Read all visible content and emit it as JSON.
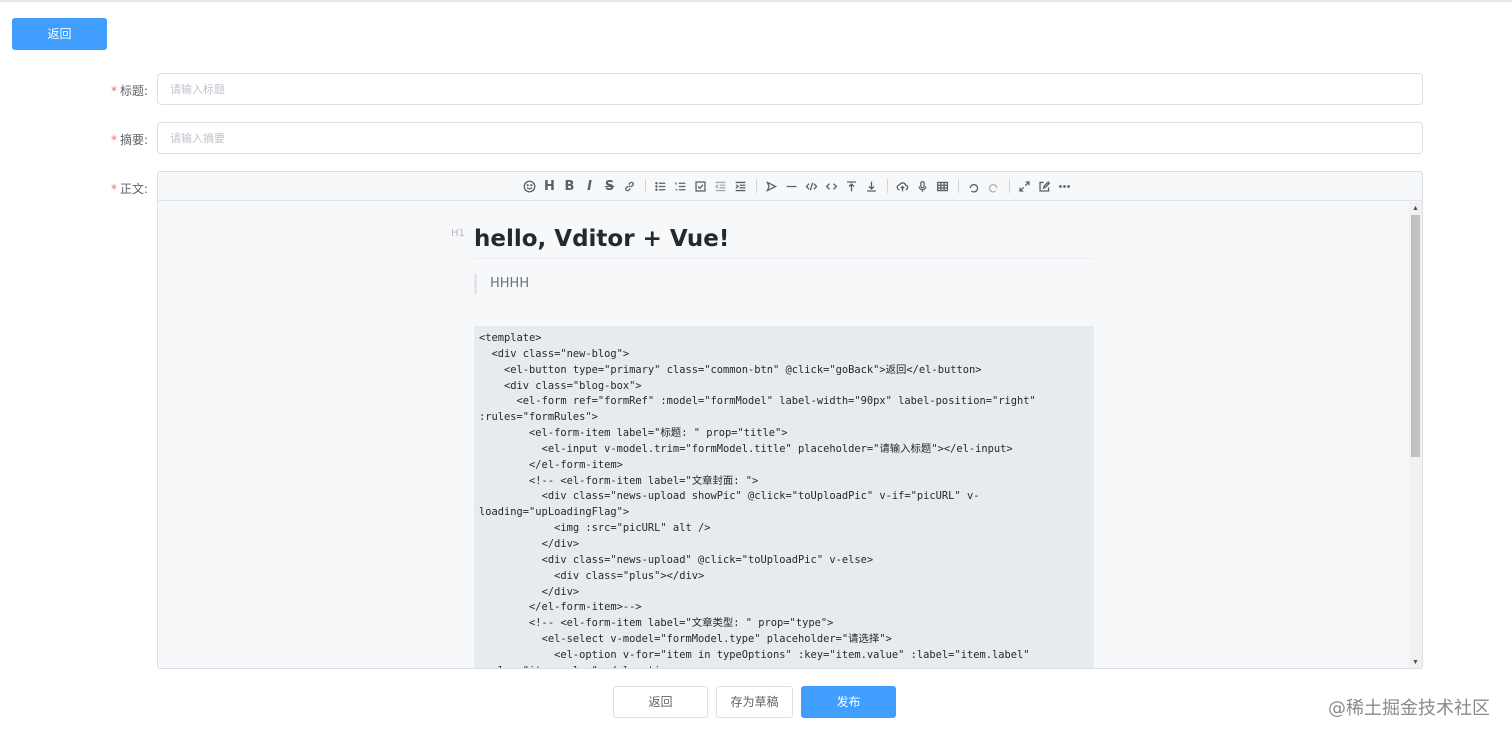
{
  "header": {
    "back_label": "返回"
  },
  "form": {
    "title": {
      "label": "标题:",
      "placeholder": "请输入标题",
      "value": ""
    },
    "summary": {
      "label": "摘要:",
      "placeholder": "请输入摘要",
      "value": ""
    },
    "body": {
      "label": "正文:"
    }
  },
  "toolbar": {
    "icons": [
      "emoji-icon",
      "headings-icon",
      "bold-icon",
      "italic-icon",
      "strike-icon",
      "link-icon",
      "list-icon",
      "ordered-list-icon",
      "check-icon",
      "outdent-icon",
      "indent-icon",
      "quote-icon",
      "line-icon",
      "code-icon",
      "inline-code-icon",
      "insert-before-icon",
      "insert-after-icon",
      "upload-icon",
      "record-icon",
      "table-icon",
      "undo-icon",
      "redo-icon",
      "fullscreen-icon",
      "edit-mode-icon",
      "more-icon"
    ],
    "headings_text": "H",
    "bold_text": "B",
    "italic_text": "I",
    "strike_text": "S"
  },
  "editor": {
    "heading_marker": "H1",
    "heading": "hello, Vditor + Vue!",
    "quote": "HHHH",
    "code": "<template>\n  <div class=\"new-blog\">\n    <el-button type=\"primary\" class=\"common-btn\" @click=\"goBack\">返回</el-button>\n    <div class=\"blog-box\">\n      <el-form ref=\"formRef\" :model=\"formModel\" label-width=\"90px\" label-position=\"right\"\n:rules=\"formRules\">\n        <el-form-item label=\"标题: \" prop=\"title\">\n          <el-input v-model.trim=\"formModel.title\" placeholder=\"请输入标题\"></el-input>\n        </el-form-item>\n        <!-- <el-form-item label=\"文章封面: \">\n          <div class=\"news-upload showPic\" @click=\"toUploadPic\" v-if=\"picURL\" v-\nloading=\"upLoadingFlag\">\n            <img :src=\"picURL\" alt />\n          </div>\n          <div class=\"news-upload\" @click=\"toUploadPic\" v-else>\n            <div class=\"plus\"></div>\n          </div>\n        </el-form-item>-->\n        <!-- <el-form-item label=\"文章类型: \" prop=\"type\">\n          <el-select v-model=\"formModel.type\" placeholder=\"请选择\">\n            <el-option v-for=\"item in typeOptions\" :key=\"item.value\" :label=\"item.label\"\n:value=\"item.value\"></el-option>"
  },
  "footer": {
    "back_label": "返回",
    "draft_label": "存为草稿",
    "publish_label": "发布"
  },
  "watermark": "@稀土掘金技术社区",
  "colors": {
    "primary": "#409eff",
    "required": "#f56c6c"
  }
}
